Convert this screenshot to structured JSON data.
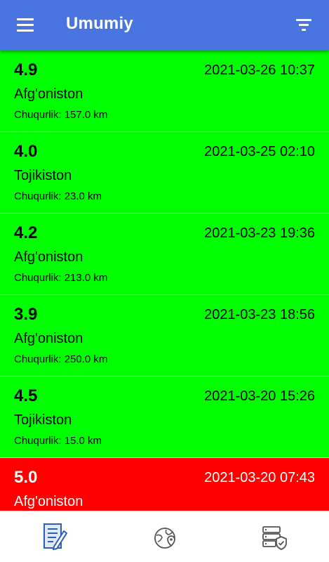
{
  "app_bar": {
    "title": "Umumiy",
    "menu_icon": "menu-icon",
    "filter_icon": "filter-icon",
    "color": "#4a74e0"
  },
  "colors": {
    "green": "#00ff00",
    "red": "#ff0000"
  },
  "earthquakes": [
    {
      "magnitude": "4.9",
      "datetime": "2021-03-26 10:37",
      "location": "Afg'oniston",
      "depth": "Chuqurlik: 157.0 km",
      "level": "green"
    },
    {
      "magnitude": "4.0",
      "datetime": "2021-03-25 02:10",
      "location": "Tojikiston",
      "depth": "Chuqurlik: 23.0 km",
      "level": "green"
    },
    {
      "magnitude": "4.2",
      "datetime": "2021-03-23 19:36",
      "location": "Afg'oniston",
      "depth": "Chuqurlik: 213.0 km",
      "level": "green"
    },
    {
      "magnitude": "3.9",
      "datetime": "2021-03-23 18:56",
      "location": "Afg'oniston",
      "depth": "Chuqurlik: 250.0 km",
      "level": "green"
    },
    {
      "magnitude": "4.5",
      "datetime": "2021-03-20 15:26",
      "location": "Tojikiston",
      "depth": "Chuqurlik: 15.0 km",
      "level": "green"
    },
    {
      "magnitude": "5.0",
      "datetime": "2021-03-20 07:43",
      "location": "Afg'oniston",
      "depth": "",
      "level": "red"
    }
  ],
  "bottom_nav": [
    {
      "icon": "document-list-icon",
      "active": true
    },
    {
      "icon": "globe-location-icon",
      "active": false
    },
    {
      "icon": "server-shield-icon",
      "active": false
    }
  ]
}
